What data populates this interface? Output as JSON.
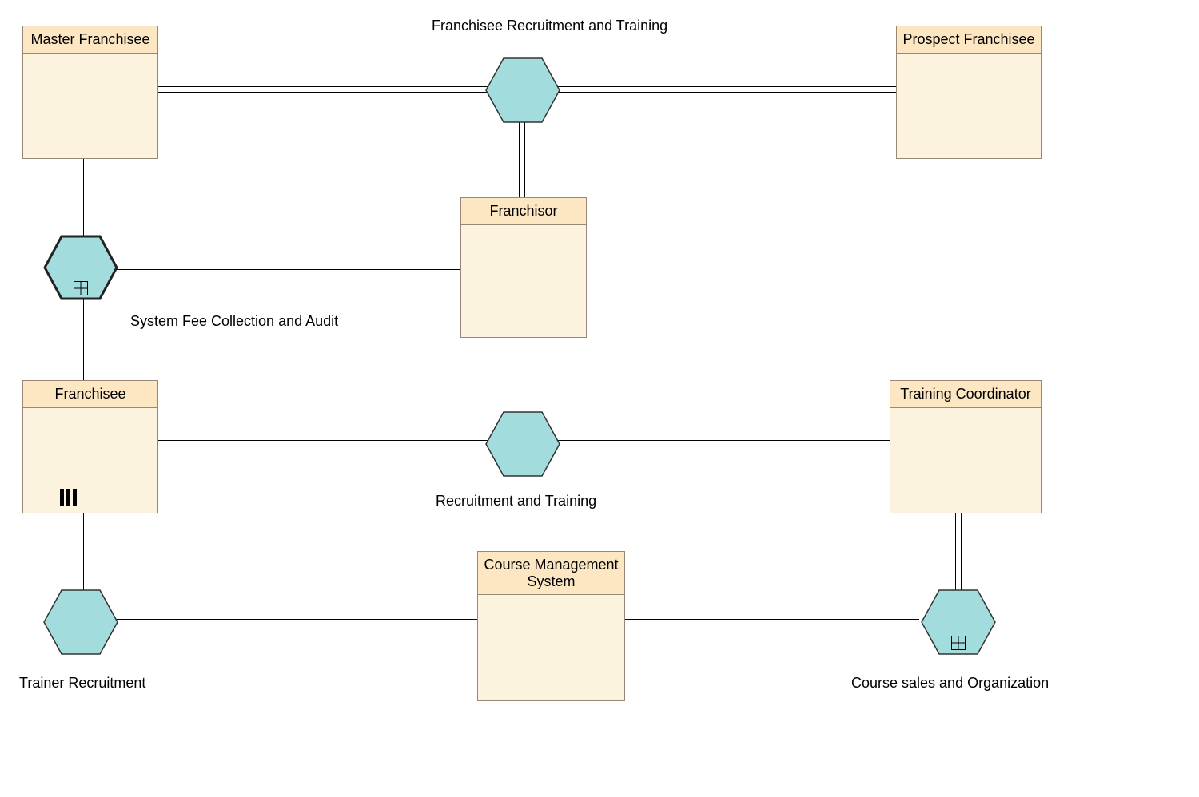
{
  "diagram": {
    "title": "Franchisee Recruitment and Training",
    "pools": {
      "masterFranchisee": {
        "label": "Master Franchisee"
      },
      "prospectFranchisee": {
        "label": "Prospect Franchisee"
      },
      "franchisor": {
        "label": "Franchisor"
      },
      "franchisee": {
        "label": "Franchisee"
      },
      "trainingCoordinator": {
        "label": "Training Coordinator"
      },
      "courseManagementSystem": {
        "label": "Course Management System"
      }
    },
    "conversations": {
      "franchiseeRecruitmentTraining": {
        "label": "Franchisee Recruitment and Training"
      },
      "systemFeeCollectionAudit": {
        "label": "System Fee Collection and Audit"
      },
      "recruitmentTraining": {
        "label": "Recruitment and Training"
      },
      "trainerRecruitment": {
        "label": "Trainer Recruitment"
      },
      "courseSalesOrganization": {
        "label": "Course sales and Organization"
      }
    }
  }
}
